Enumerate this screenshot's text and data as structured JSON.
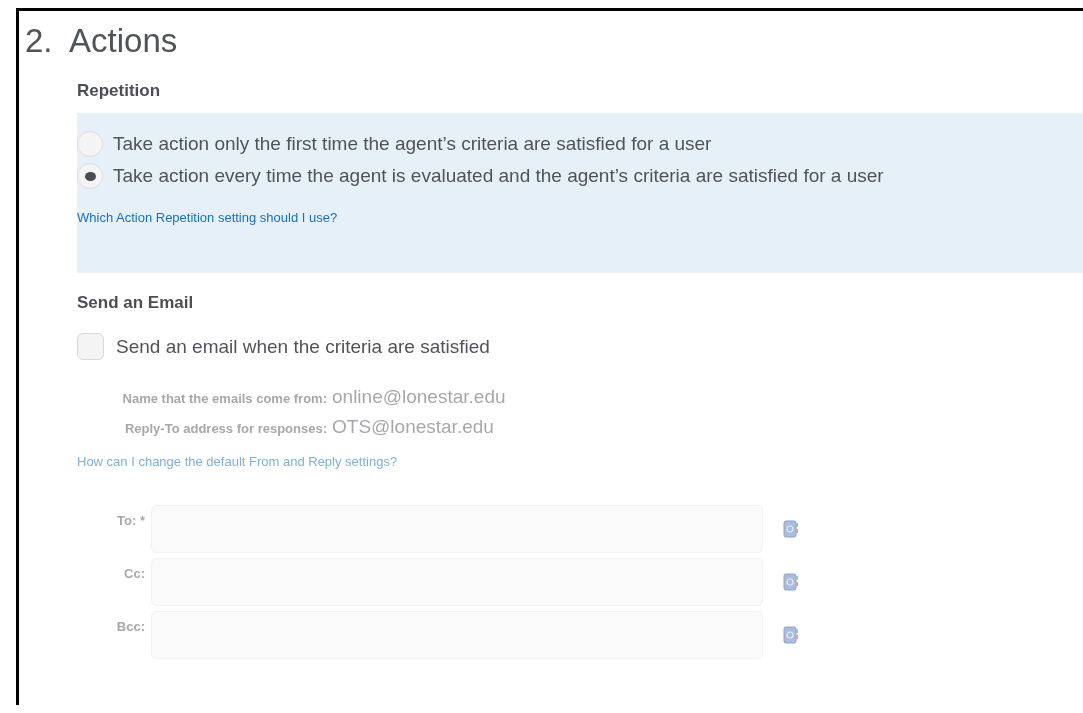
{
  "title": "2.  Actions",
  "repetition": {
    "heading": "Repetition",
    "options": [
      {
        "label": "Take action only the first time the agent’s criteria are satisfied for a user",
        "selected": false
      },
      {
        "label": "Take action every time the agent is evaluated and the agent’s criteria are satisfied for a user",
        "selected": true
      }
    ],
    "help_link": "Which Action Repetition setting should I use?"
  },
  "email": {
    "heading": "Send an Email",
    "checkbox": {
      "label": "Send an email when the criteria are satisfied",
      "checked": false
    },
    "info": [
      {
        "label": "Name that the emails come from:",
        "value": "online@lonestar.edu"
      },
      {
        "label": "Reply-To address for responses:",
        "value": "OTS@lonestar.edu"
      }
    ],
    "help_link": "How can I change the default From and Reply settings?",
    "fields": [
      {
        "label": "To:",
        "required_mark": "*"
      },
      {
        "label": "Cc:"
      },
      {
        "label": "Bcc:"
      }
    ]
  }
}
